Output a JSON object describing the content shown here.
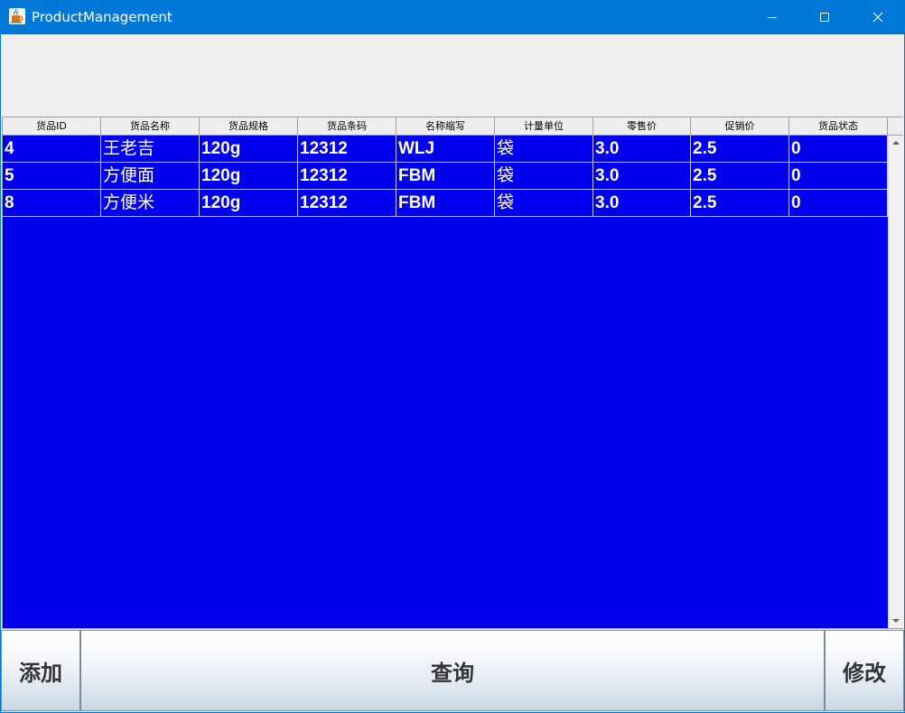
{
  "window": {
    "title": "ProductManagement"
  },
  "table": {
    "columns": [
      "货品ID",
      "货品名称",
      "货品规格",
      "货品条码",
      "名称缩写",
      "计量单位",
      "零售价",
      "促销价",
      "货品状态"
    ],
    "rows": [
      [
        "4",
        "王老吉",
        "120g",
        "12312",
        "WLJ",
        "袋",
        "3.0",
        "2.5",
        "0"
      ],
      [
        "5",
        "方便面",
        "120g",
        "12312",
        "FBM",
        "袋",
        "3.0",
        "2.5",
        "0"
      ],
      [
        "8",
        "方便米",
        "120g",
        "12312",
        "FBM",
        "袋",
        "3.0",
        "2.5",
        "0"
      ]
    ],
    "background_color": "#0000ee",
    "text_color": "#ffffff"
  },
  "buttons": {
    "add_label": "添加",
    "query_label": "查询",
    "edit_label": "修改"
  },
  "icons": {
    "app": "java-coffee-cup-icon",
    "minimize": "minimize-icon",
    "maximize": "maximize-icon",
    "close": "close-icon",
    "scroll_up": "arrow-up-icon",
    "scroll_down": "arrow-down-icon"
  },
  "colors": {
    "titlebar": "#0078d7",
    "panel": "#eeeeee"
  }
}
